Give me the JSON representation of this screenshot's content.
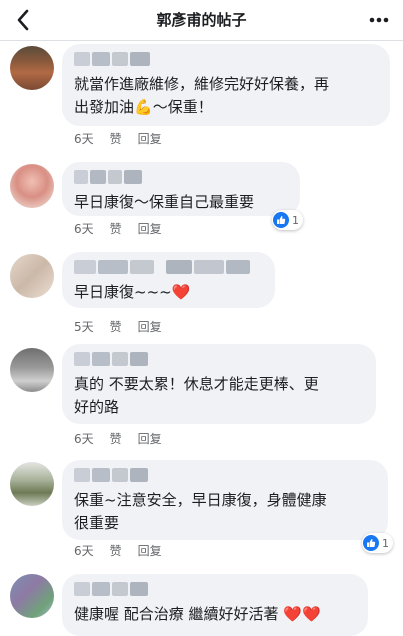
{
  "header": {
    "title": "郭彥甫的帖子",
    "back_icon": "chevron-left-icon",
    "more_icon": "ellipsis-icon"
  },
  "labels": {
    "like": "赞",
    "reply": "回复"
  },
  "colors": {
    "bubble": "#f0f2f5",
    "meta_text": "#65676b",
    "like_blue": "#1877f2",
    "heart_red": "#e41e3f"
  },
  "comments": [
    {
      "text": "就當作進廠維修，維修完好好保養，再\n出發加油",
      "emoji_after": "💪",
      "text_tail": "～保重！",
      "time": "6天"
    },
    {
      "text": "早日康復～保重自己最重要",
      "time": "6天",
      "reactions": "1"
    },
    {
      "text": "早日康復~~~",
      "emoji_after": "❤️",
      "time": "5天"
    },
    {
      "text": "真的 不要太累！休息才能走更棒、更\n好的路",
      "time": "6天"
    },
    {
      "text": "保重~注意安全，早日康復，身體健康\n很重要",
      "time": "6天",
      "reactions": "1"
    },
    {
      "text": "健康喔 配合治療 繼續好好活著",
      "emoji_after": "❤️❤️"
    }
  ]
}
